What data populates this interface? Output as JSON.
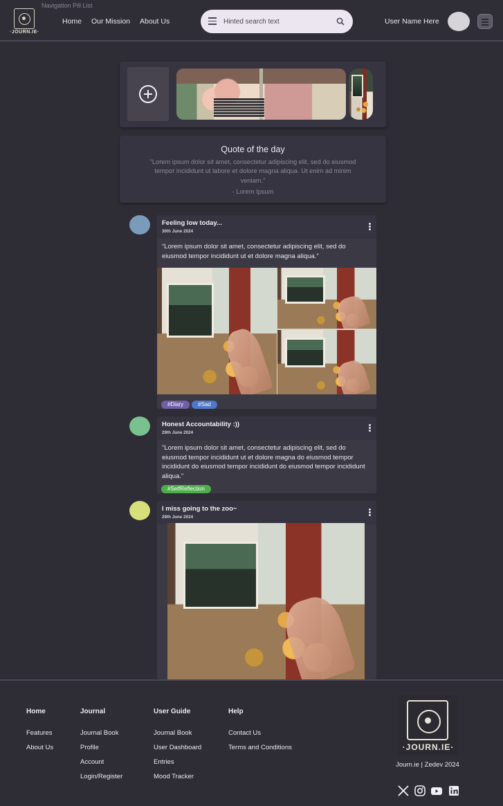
{
  "header": {
    "nav_caption": "Navigation Pill List",
    "logo_text": "·JOURN.IE·",
    "nav_links": [
      "Home",
      "Our Mission",
      "About Us"
    ],
    "search_placeholder": "Hinted search text",
    "user_name": "User Name Here"
  },
  "quote": {
    "title": "Quote of the day",
    "text": "\"Lorem ipsum dolor sit amet, consectetur adipiscing elit, sed do eiusmod tempor incididunt ut labore et dolore magna aliqua. Ut enim ad minim veniam.\"",
    "author": "- Lorem Ipsum"
  },
  "posts": [
    {
      "title": "Feeling low today...",
      "date": "30th June 2024",
      "body": "“Lorem ipsum dolor sit amet, consectetur adipiscing elit, sed do eiusmod tempor incididunt ut  et dolore magna aliqua.”",
      "tags": [
        "#Diary",
        "#Sad"
      ],
      "avatar_color": "#7b9bbb"
    },
    {
      "title": "Honest Accountability :))",
      "date": "29th June 2024",
      "body": "\"Lorem ipsum dolor sit amet, consectetur adipiscing elit, sed do eiusmod tempor incididunt ut  et dolore magna do eiusmod tempor incididunt do eiusmod tempor incididunt do eiusmod tempor incididunt aliqua.\"",
      "tags": [
        "#SelfReflection"
      ],
      "avatar_color": "#79c18f"
    },
    {
      "title": "I miss going to the zoo~",
      "date": "29th June 2024",
      "avatar_color": "#d7df7a"
    }
  ],
  "tag_colors": {
    "#Diary": "#6f5fa6",
    "#Sad": "#4f78c8",
    "#SelfReflection": "#4fae4c"
  },
  "footer": {
    "columns": [
      {
        "heading": "Home",
        "links": [
          "Features",
          "About Us"
        ]
      },
      {
        "heading": "Journal",
        "links": [
          "Journal Book",
          "Profile",
          "Account",
          "Login/Register"
        ]
      },
      {
        "heading": "User Guide",
        "links": [
          "Journal Book",
          "User Dashboard",
          "Entries",
          "Mood Tracker"
        ]
      },
      {
        "heading": "Help",
        "links": [
          "Contact Us",
          "Terms and Conditions"
        ]
      }
    ],
    "logo_text": "·JOURN.IE·",
    "copyright": "Journ.ie | Zedev 2024",
    "socials": [
      "x-icon",
      "instagram-icon",
      "youtube-icon",
      "linkedin-icon"
    ]
  }
}
